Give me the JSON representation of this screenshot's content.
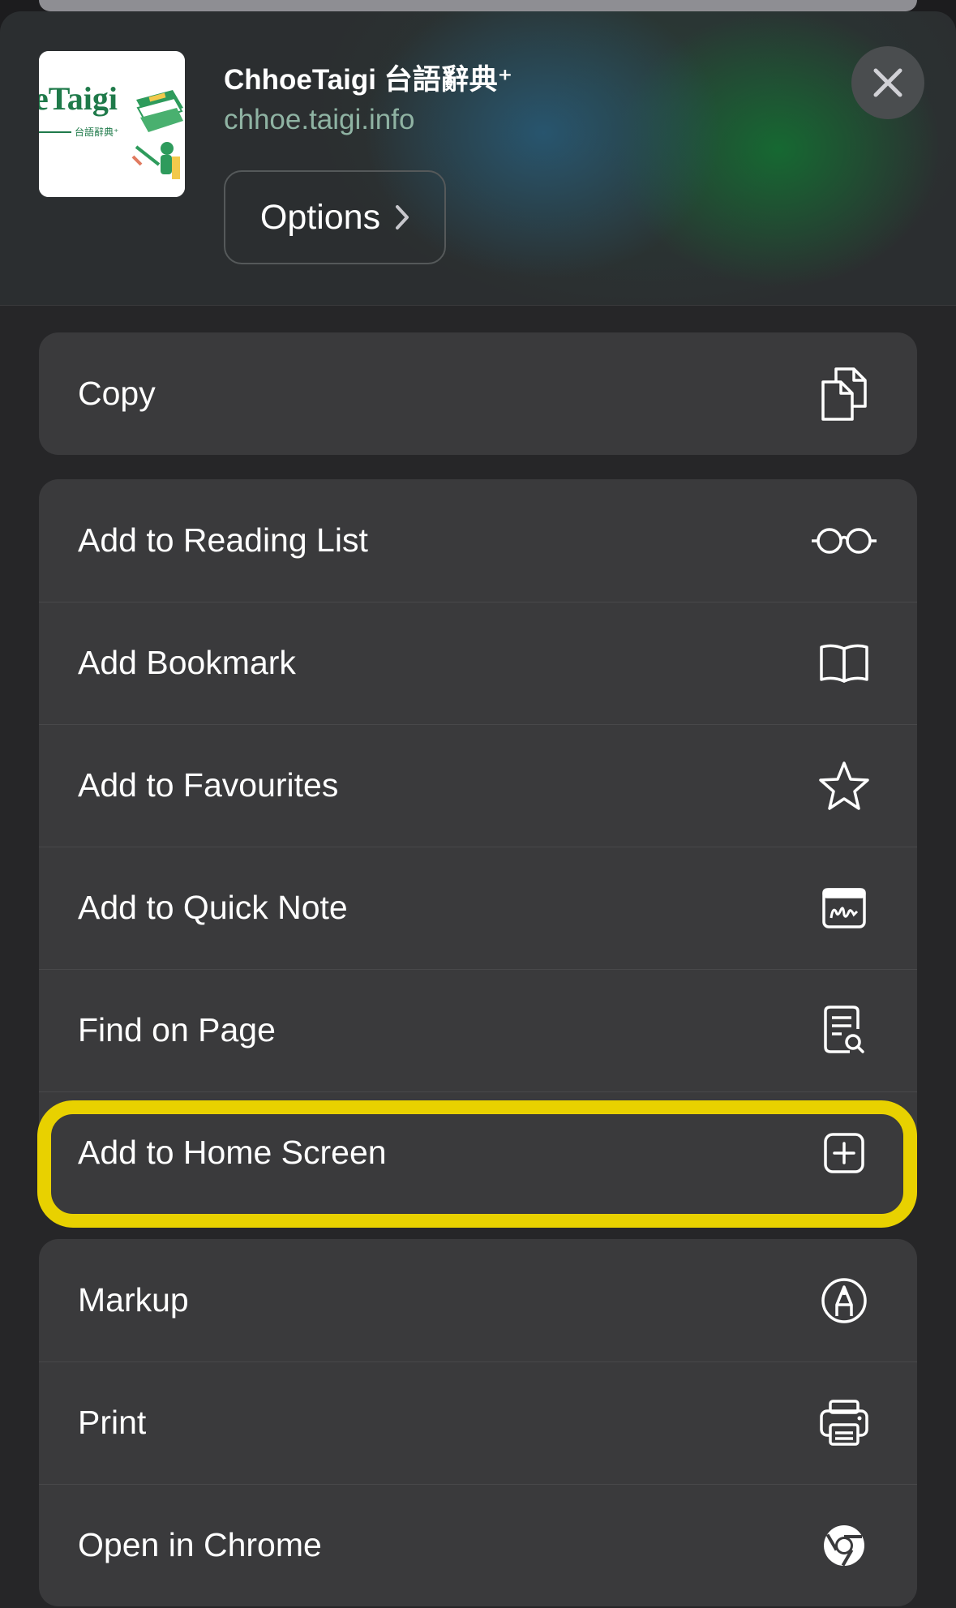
{
  "header": {
    "site_title": "ChhoeTaigi 台語辭典⁺",
    "site_url": "chhoe.taigi.info",
    "options_label": "Options",
    "logo_text": "eTaigi",
    "logo_subtext": "台語辭典⁺",
    "close_icon": "close-icon"
  },
  "groups": [
    {
      "items": [
        {
          "label": "Copy",
          "icon": "copy-icon"
        }
      ]
    },
    {
      "items": [
        {
          "label": "Add to Reading List",
          "icon": "glasses-icon"
        },
        {
          "label": "Add Bookmark",
          "icon": "book-icon"
        },
        {
          "label": "Add to Favourites",
          "icon": "star-icon"
        },
        {
          "label": "Add to Quick Note",
          "icon": "quick-note-icon"
        },
        {
          "label": "Find on Page",
          "icon": "find-on-page-icon"
        },
        {
          "label": "Add to Home Screen",
          "icon": "add-square-icon"
        }
      ]
    },
    {
      "items": [
        {
          "label": "Markup",
          "icon": "markup-icon"
        },
        {
          "label": "Print",
          "icon": "printer-icon"
        },
        {
          "label": "Open in Chrome",
          "icon": "chrome-icon"
        }
      ]
    }
  ],
  "highlight_color": "#e8d100"
}
